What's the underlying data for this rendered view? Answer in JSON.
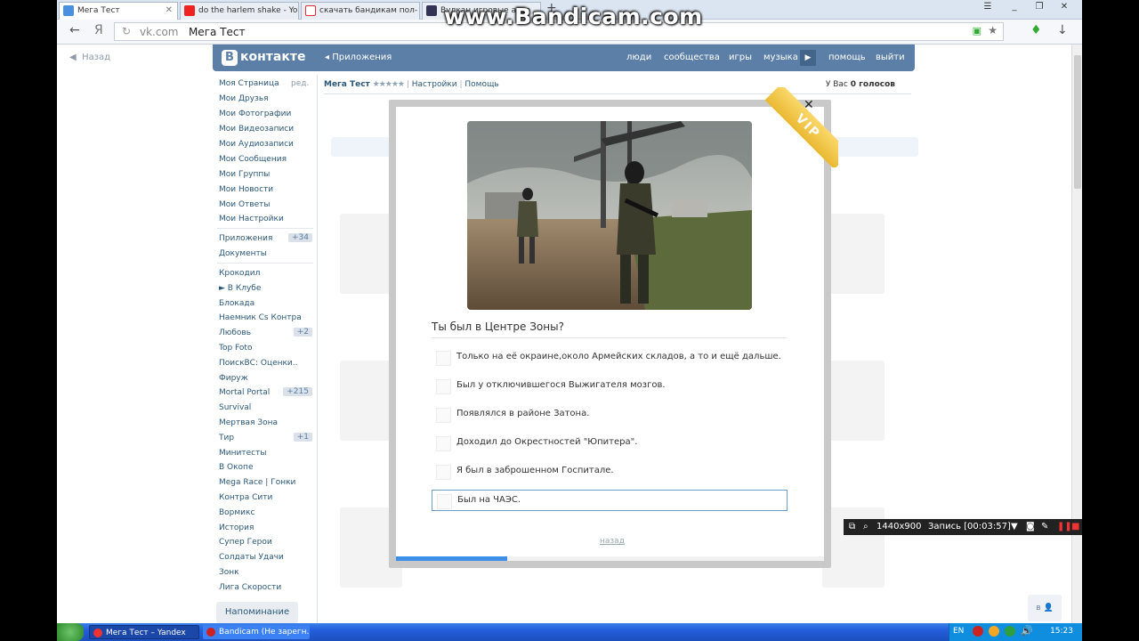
{
  "browser": {
    "tabs": [
      {
        "label": "Мега Тест",
        "active": true
      },
      {
        "label": "do the harlem shake - Yo",
        "active": false
      },
      {
        "label": "скачать бандикам пол-",
        "active": false
      },
      {
        "label": "Вулкан игровые авто",
        "active": false
      }
    ],
    "address": {
      "host": "vk.com",
      "title": "Мега Тест"
    }
  },
  "watermark": "www.Bandicam.com",
  "page": {
    "back_label": "Назад",
    "header": {
      "logo": "контакте",
      "apps": "Приложения",
      "nav": [
        "люди",
        "сообщества",
        "игры",
        "музыка",
        "помощь",
        "выйти"
      ]
    },
    "sidebar": {
      "edit_label": "ред.",
      "main_items": [
        "Моя Страница",
        "Мои Друзья",
        "Мои Фотографии",
        "Мои Видеозаписи",
        "Мои Аудиозаписи",
        "Мои Сообщения",
        "Мои Группы",
        "Мои Новости",
        "Мои Ответы",
        "Мои Настройки"
      ],
      "app_items": [
        {
          "label": "Приложения",
          "badge": "+34"
        },
        {
          "label": "Документы",
          "badge": ""
        }
      ],
      "games": [
        {
          "label": "Крокодил",
          "badge": ""
        },
        {
          "label": "► В Клубе",
          "badge": ""
        },
        {
          "label": "Блокада",
          "badge": ""
        },
        {
          "label": "Наемник Cs Контра",
          "badge": ""
        },
        {
          "label": "Любовь",
          "badge": "+2"
        },
        {
          "label": "Top Foto",
          "badge": ""
        },
        {
          "label": "ПоискВС: Оценки..",
          "badge": ""
        },
        {
          "label": "Фируж",
          "badge": ""
        },
        {
          "label": "Mortal Portal",
          "badge": "+215"
        },
        {
          "label": "Survival",
          "badge": ""
        },
        {
          "label": "Мертвая Зона",
          "badge": ""
        },
        {
          "label": "Тир",
          "badge": "+1"
        },
        {
          "label": "Минитесты",
          "badge": ""
        },
        {
          "label": "В Окопе",
          "badge": ""
        },
        {
          "label": "Mega Race | Гонки",
          "badge": ""
        },
        {
          "label": "Контра Сити",
          "badge": ""
        },
        {
          "label": "Вормикс",
          "badge": ""
        },
        {
          "label": "История",
          "badge": ""
        },
        {
          "label": "Супер Герои",
          "badge": ""
        },
        {
          "label": "Солдаты Удачи",
          "badge": ""
        },
        {
          "label": "Зонк",
          "badge": ""
        },
        {
          "label": "Лига Скорости",
          "badge": ""
        }
      ],
      "reminder": "Напоминание"
    },
    "appbar": {
      "name": "Мега Тест",
      "stars": "★★★★★",
      "settings": "Настройки",
      "help": "Помощь",
      "votes_prefix": "У Вас",
      "votes_count": "0 голосов"
    },
    "dialog": {
      "badge": "VIP",
      "question": "Ты был в Центре Зоны?",
      "options": [
        "Только на её окраине,около Армейских складов, а то и ещё дальше.",
        "Был у отключившегося Выжигателя мозгов.",
        "Появлялся в районе Затона.",
        "Доходил до Окрестностей \"Юпитера\".",
        "Я был в заброшенном Госпитале.",
        "Был на ЧАЭС."
      ],
      "selected_option": 5,
      "back_label": "назад",
      "progress": 0.26
    },
    "help_button": "в"
  },
  "bandicam": {
    "resolution": "1440x900",
    "record_label": "Запись [00:03:57]"
  },
  "taskbar": {
    "tasks": [
      "Мега Тест – Yandex",
      "Bandicam (Не зарегн..."
    ],
    "lang": "EN",
    "clock": "15:23"
  },
  "colors": {
    "vk_header": "#5b7fa6",
    "link": "#2b587a",
    "progress": "#3d8ee6",
    "vip": "#f1c440"
  }
}
